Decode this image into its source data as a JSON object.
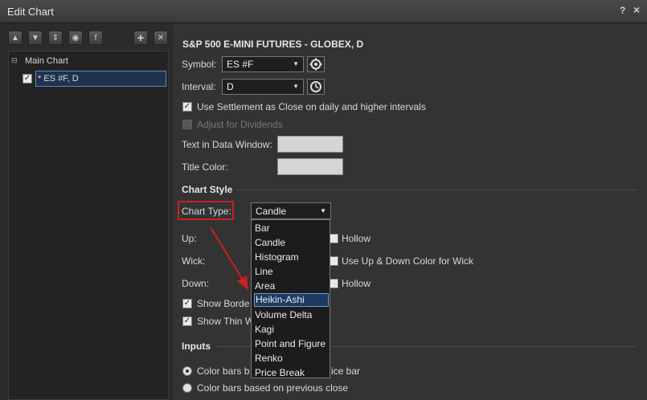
{
  "window": {
    "title": "Edit Chart",
    "help": "?",
    "close": "×"
  },
  "left_toolbar": {
    "buttons": [
      {
        "icon": "move-up-icon",
        "glyph": "▲"
      },
      {
        "icon": "move-down-icon",
        "glyph": "▼"
      },
      {
        "icon": "sort-icon",
        "glyph": "⇕"
      },
      {
        "icon": "eye-icon",
        "glyph": "◉"
      },
      {
        "icon": "formula-icon",
        "glyph": "f"
      },
      {
        "icon": "add-icon",
        "glyph": "+"
      },
      {
        "icon": "delete-icon",
        "glyph": "✕"
      }
    ]
  },
  "tree": {
    "root": "Main Chart",
    "child": "* ES #F, D"
  },
  "panel": {
    "heading": "S&P 500 E-MINI FUTURES - GLOBEX, D",
    "symbol_label": "Symbol:",
    "symbol_value": "ES #F",
    "interval_label": "Interval:",
    "interval_value": "D",
    "settlement_label": "Use Settlement as Close on daily and higher intervals",
    "dividends_label": "Adjust for Dividends",
    "data_window_label": "Text in Data Window:",
    "title_color_label": "Title Color:",
    "chart_style_heading": "Chart Style",
    "chart_type_label": "Chart Type:",
    "chart_type_value": "Candle",
    "up_label": "Up:",
    "wick_label": "Wick:",
    "down_label": "Down:",
    "hollow_label_1": "Hollow",
    "wick_option_label": "Use Up & Down Color for Wick",
    "hollow_label_2": "Hollow",
    "show_borders_label": "Show Borde",
    "show_thin_label": "Show Thin W",
    "inputs_heading": "Inputs",
    "radio1_prefix": "Color bars b",
    "radio1_suffix": "ice bar",
    "radio2_label": "Color bars based on previous close"
  },
  "dropdown": {
    "items": [
      "Bar",
      "Candle",
      "Histogram",
      "Line",
      "Area",
      "Heikin-Ashi",
      "Volume Delta",
      "Kagi",
      "Point and Figure",
      "Renko",
      "Price Break"
    ],
    "selected": "Heikin-Ashi"
  },
  "colors": {
    "highlight": "#cc1f1f",
    "selection": "#1e3a63",
    "arrow": "#cc1f1f"
  }
}
